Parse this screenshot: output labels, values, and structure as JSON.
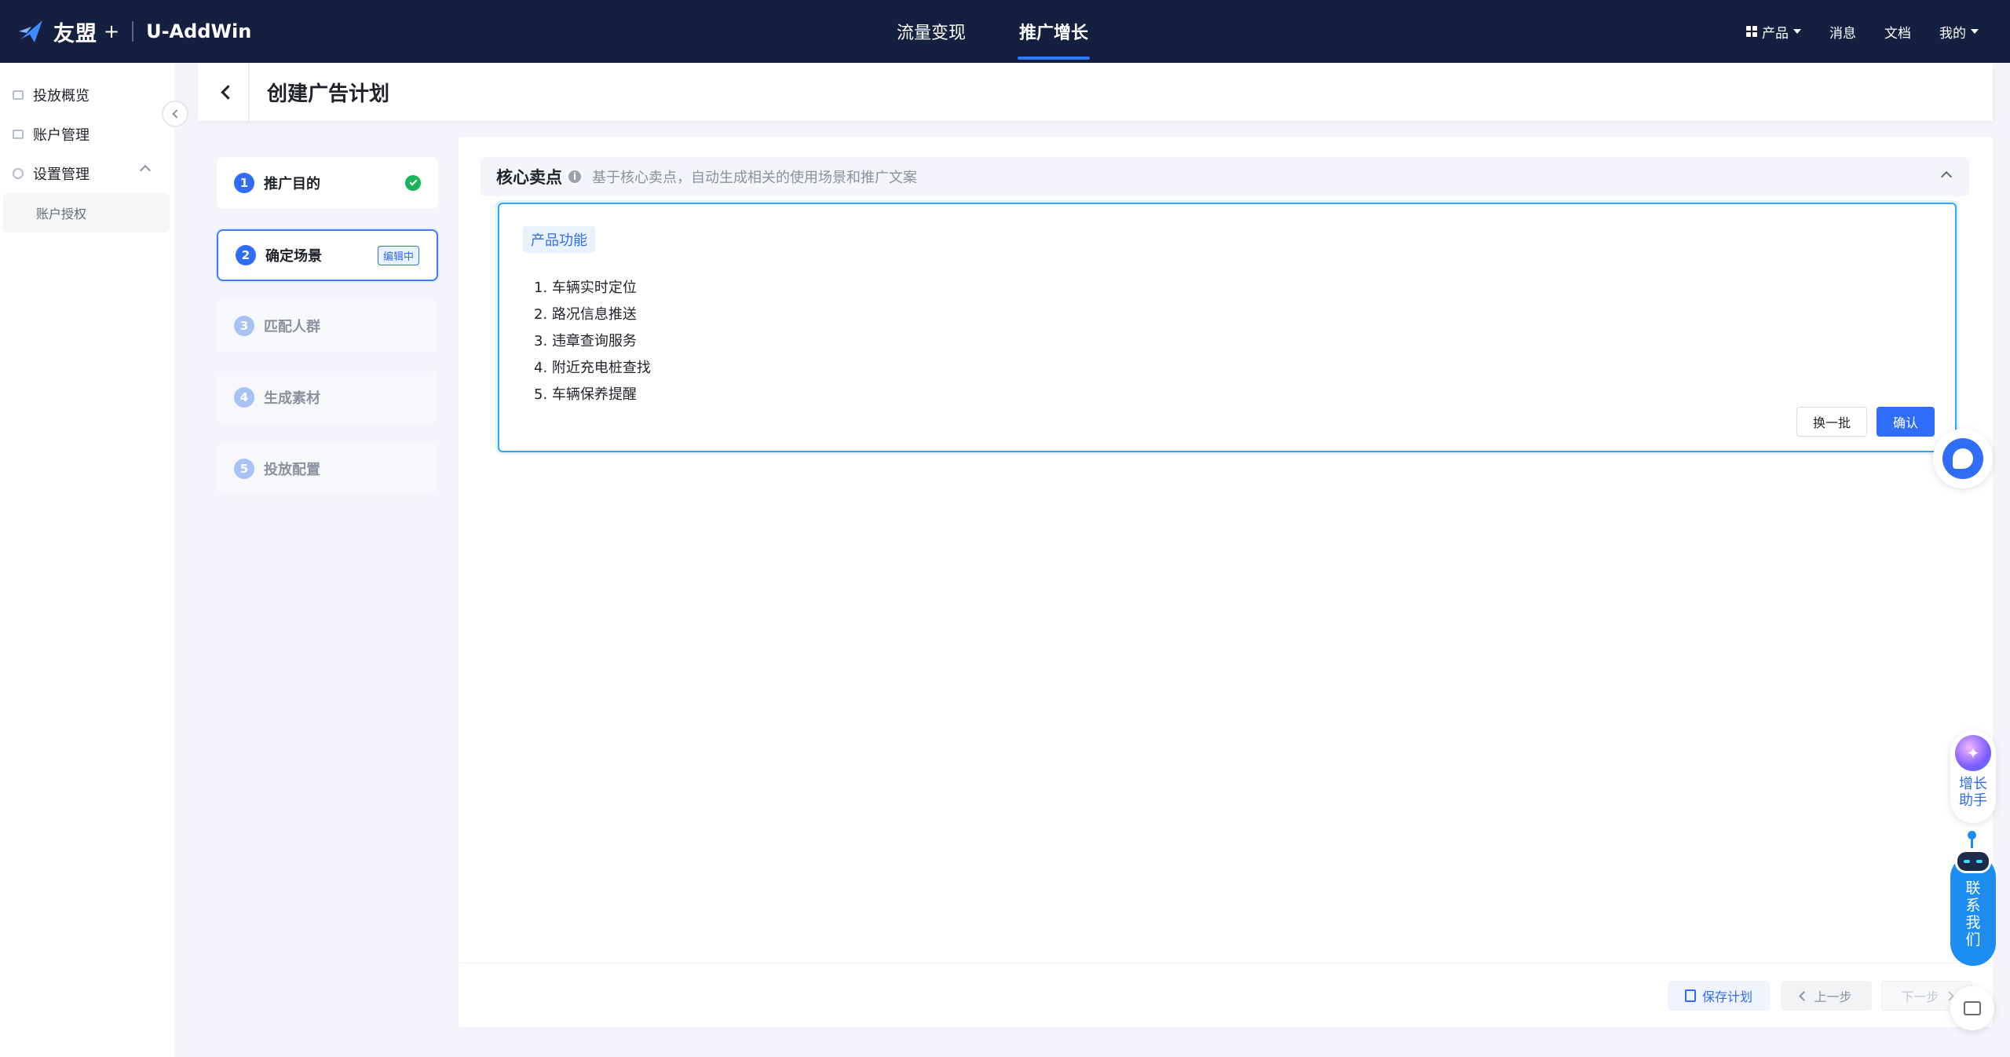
{
  "app": {
    "brand_name": "友盟",
    "brand_plus": "+",
    "product_name": "U-AddWin"
  },
  "topnav": {
    "tabs": [
      {
        "label": "流量变现",
        "active": false
      },
      {
        "label": "推广增长",
        "active": true
      }
    ],
    "right": {
      "products": "产品",
      "messages": "消息",
      "docs": "文档",
      "mine": "我的"
    }
  },
  "sidebar": {
    "items": [
      {
        "label": "投放概览"
      },
      {
        "label": "账户管理"
      },
      {
        "label": "设置管理"
      }
    ],
    "sub_items": [
      {
        "label": "账户授权"
      }
    ]
  },
  "page": {
    "title": "创建广告计划"
  },
  "steps": [
    {
      "num": "1",
      "label": "推广目的",
      "state": "done"
    },
    {
      "num": "2",
      "label": "确定场景",
      "state": "active",
      "badge": "编辑中"
    },
    {
      "num": "3",
      "label": "匹配人群",
      "state": "disabled"
    },
    {
      "num": "4",
      "label": "生成素材",
      "state": "disabled"
    },
    {
      "num": "5",
      "label": "投放配置",
      "state": "disabled"
    }
  ],
  "section": {
    "title": "核心卖点",
    "info_icon": "i",
    "description": "基于核心卖点，自动生成相关的使用场景和推广文案"
  },
  "feature": {
    "tag": "产品功能",
    "items": [
      "1. 车辆实时定位",
      "2. 路况信息推送",
      "3. 违章查询服务",
      "4. 附近充电桩查找",
      "5. 车辆保养提醒"
    ],
    "swap_label": "换一批",
    "confirm_label": "确认"
  },
  "footer": {
    "save_label": "保存计划",
    "prev_label": "上一步",
    "next_label": "下一步"
  },
  "floating": {
    "growth_label": "增长助手",
    "contact_label": "联系我们"
  },
  "colors": {
    "topbar": "#152040",
    "primary": "#2f6df6",
    "success": "#18b45a",
    "contact": "#1e8df2"
  }
}
